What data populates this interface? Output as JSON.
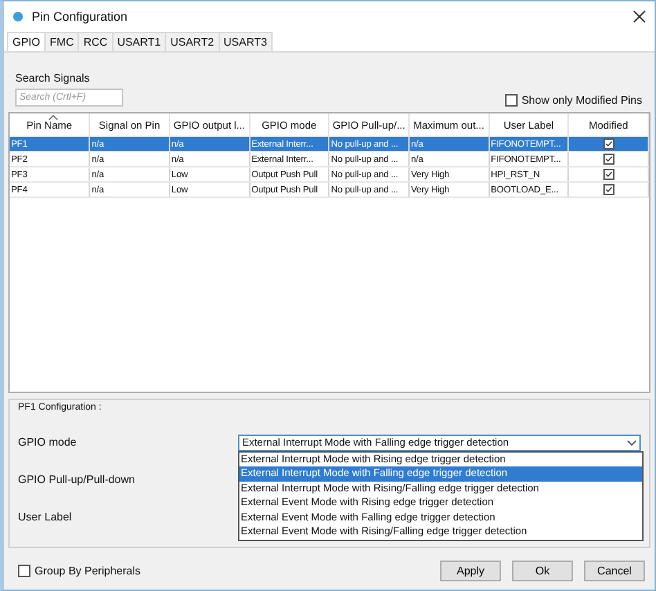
{
  "window": {
    "title": "Pin Configuration"
  },
  "tabs": [
    {
      "label": "GPIO",
      "selected": true
    },
    {
      "label": "FMC",
      "selected": false
    },
    {
      "label": "RCC",
      "selected": false
    },
    {
      "label": "USART1",
      "selected": false
    },
    {
      "label": "USART2",
      "selected": false
    },
    {
      "label": "USART3",
      "selected": false
    }
  ],
  "search": {
    "label": "Search Signals",
    "placeholder": "Search (Crtl+F)"
  },
  "filter_checkbox": {
    "label": "Show only Modified Pins",
    "checked": false
  },
  "table": {
    "columns": [
      {
        "label": "Pin Name",
        "sorted": true
      },
      {
        "label": "Signal on Pin",
        "sorted": false
      },
      {
        "label": "GPIO output l...",
        "sorted": false
      },
      {
        "label": "GPIO mode",
        "sorted": false
      },
      {
        "label": "GPIO Pull-up/...",
        "sorted": false
      },
      {
        "label": "Maximum out...",
        "sorted": false
      },
      {
        "label": "User Label",
        "sorted": false
      },
      {
        "label": "Modified",
        "sorted": false
      }
    ],
    "rows": [
      {
        "cells": [
          "PF1",
          "n/a",
          "n/a",
          "External Interr...",
          "No pull-up and ...",
          "n/a",
          "FIFONOTEMPT..."
        ],
        "modified": true,
        "selected": true
      },
      {
        "cells": [
          "PF2",
          "n/a",
          "n/a",
          "External Interr...",
          "No pull-up and ...",
          "n/a",
          "FIFONOTEMPT..."
        ],
        "modified": true,
        "selected": false
      },
      {
        "cells": [
          "PF3",
          "n/a",
          "Low",
          "Output Push Pull",
          "No pull-up and ...",
          "Very High",
          "HPI_RST_N"
        ],
        "modified": true,
        "selected": false
      },
      {
        "cells": [
          "PF4",
          "n/a",
          "Low",
          "Output Push Pull",
          "No pull-up and ...",
          "Very High",
          "BOOTLOAD_E..."
        ],
        "modified": true,
        "selected": false
      }
    ]
  },
  "config": {
    "title": "PF1 Configuration :",
    "fields": [
      {
        "label": "GPIO mode",
        "dropdown": {
          "value": "External Interrupt Mode with Falling edge trigger detection",
          "expanded": true,
          "options": [
            {
              "label": "External Interrupt Mode with Rising edge trigger detection",
              "selected": false
            },
            {
              "label": "External Interrupt Mode with Falling edge trigger detection",
              "selected": true
            },
            {
              "label": "External Interrupt Mode with Rising/Falling edge trigger detection",
              "selected": false
            },
            {
              "label": "External Event Mode with Rising edge trigger detection",
              "selected": false
            },
            {
              "label": "External Event Mode with Falling edge trigger detection",
              "selected": false
            },
            {
              "label": "External Event Mode with Rising/Falling edge trigger detection",
              "selected": false
            }
          ]
        }
      },
      {
        "label": "GPIO Pull-up/Pull-down"
      },
      {
        "label": "User Label"
      }
    ]
  },
  "group_checkbox": {
    "label": "Group By Peripherals",
    "checked": false
  },
  "buttons": [
    "Apply",
    "Ok",
    "Cancel"
  ]
}
